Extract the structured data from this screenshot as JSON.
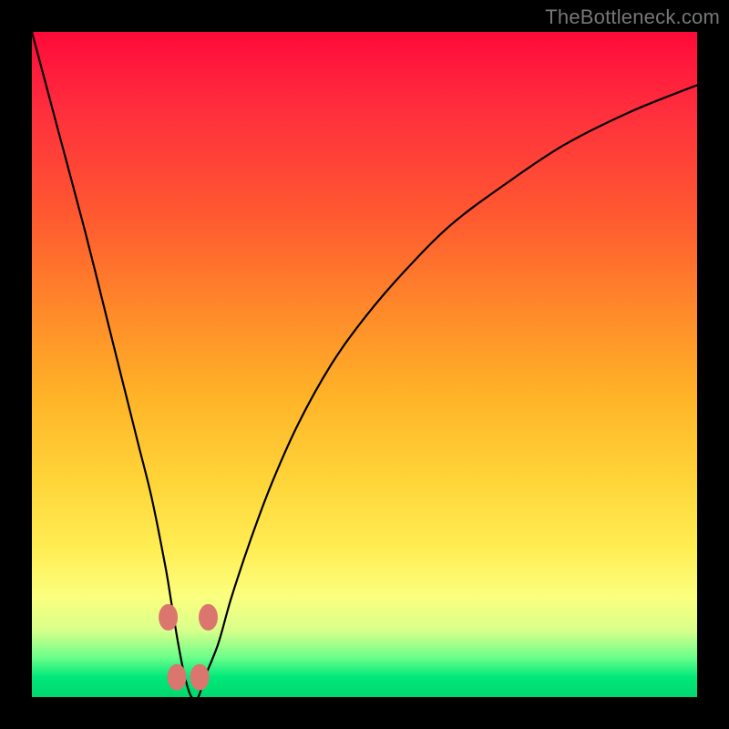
{
  "watermark": "TheBottleneck.com",
  "colors": {
    "background": "#000000",
    "gradient_top": "#ff0a3a",
    "gradient_mid1": "#ff8a2a",
    "gradient_mid2": "#ffee55",
    "gradient_bottom": "#00d86e",
    "curve": "#000000",
    "markers": "#db766e"
  },
  "chart_data": {
    "type": "line",
    "title": "",
    "xlabel": "",
    "ylabel": "",
    "xlim": [
      0,
      100
    ],
    "ylim": [
      0,
      100
    ],
    "grid": false,
    "series": [
      {
        "name": "bottleneck-curve",
        "x": [
          0,
          4,
          8,
          12,
          14,
          16,
          18,
          20,
          21,
          22,
          23,
          24,
          25,
          26,
          28,
          30,
          33,
          36,
          40,
          45,
          50,
          56,
          63,
          71,
          80,
          90,
          100
        ],
        "values": [
          100,
          85,
          70,
          54,
          46,
          38,
          30,
          20,
          14,
          8,
          3,
          0,
          0,
          3,
          8,
          15,
          24,
          32,
          41,
          50,
          57,
          64,
          71,
          77,
          83,
          88,
          92
        ]
      }
    ],
    "markers": [
      {
        "x": 20.5,
        "y": 12
      },
      {
        "x": 21.8,
        "y": 3
      },
      {
        "x": 25.2,
        "y": 3
      },
      {
        "x": 26.5,
        "y": 12
      }
    ],
    "annotations": [
      {
        "text": "TheBottleneck.com",
        "position": "top-right"
      }
    ]
  }
}
